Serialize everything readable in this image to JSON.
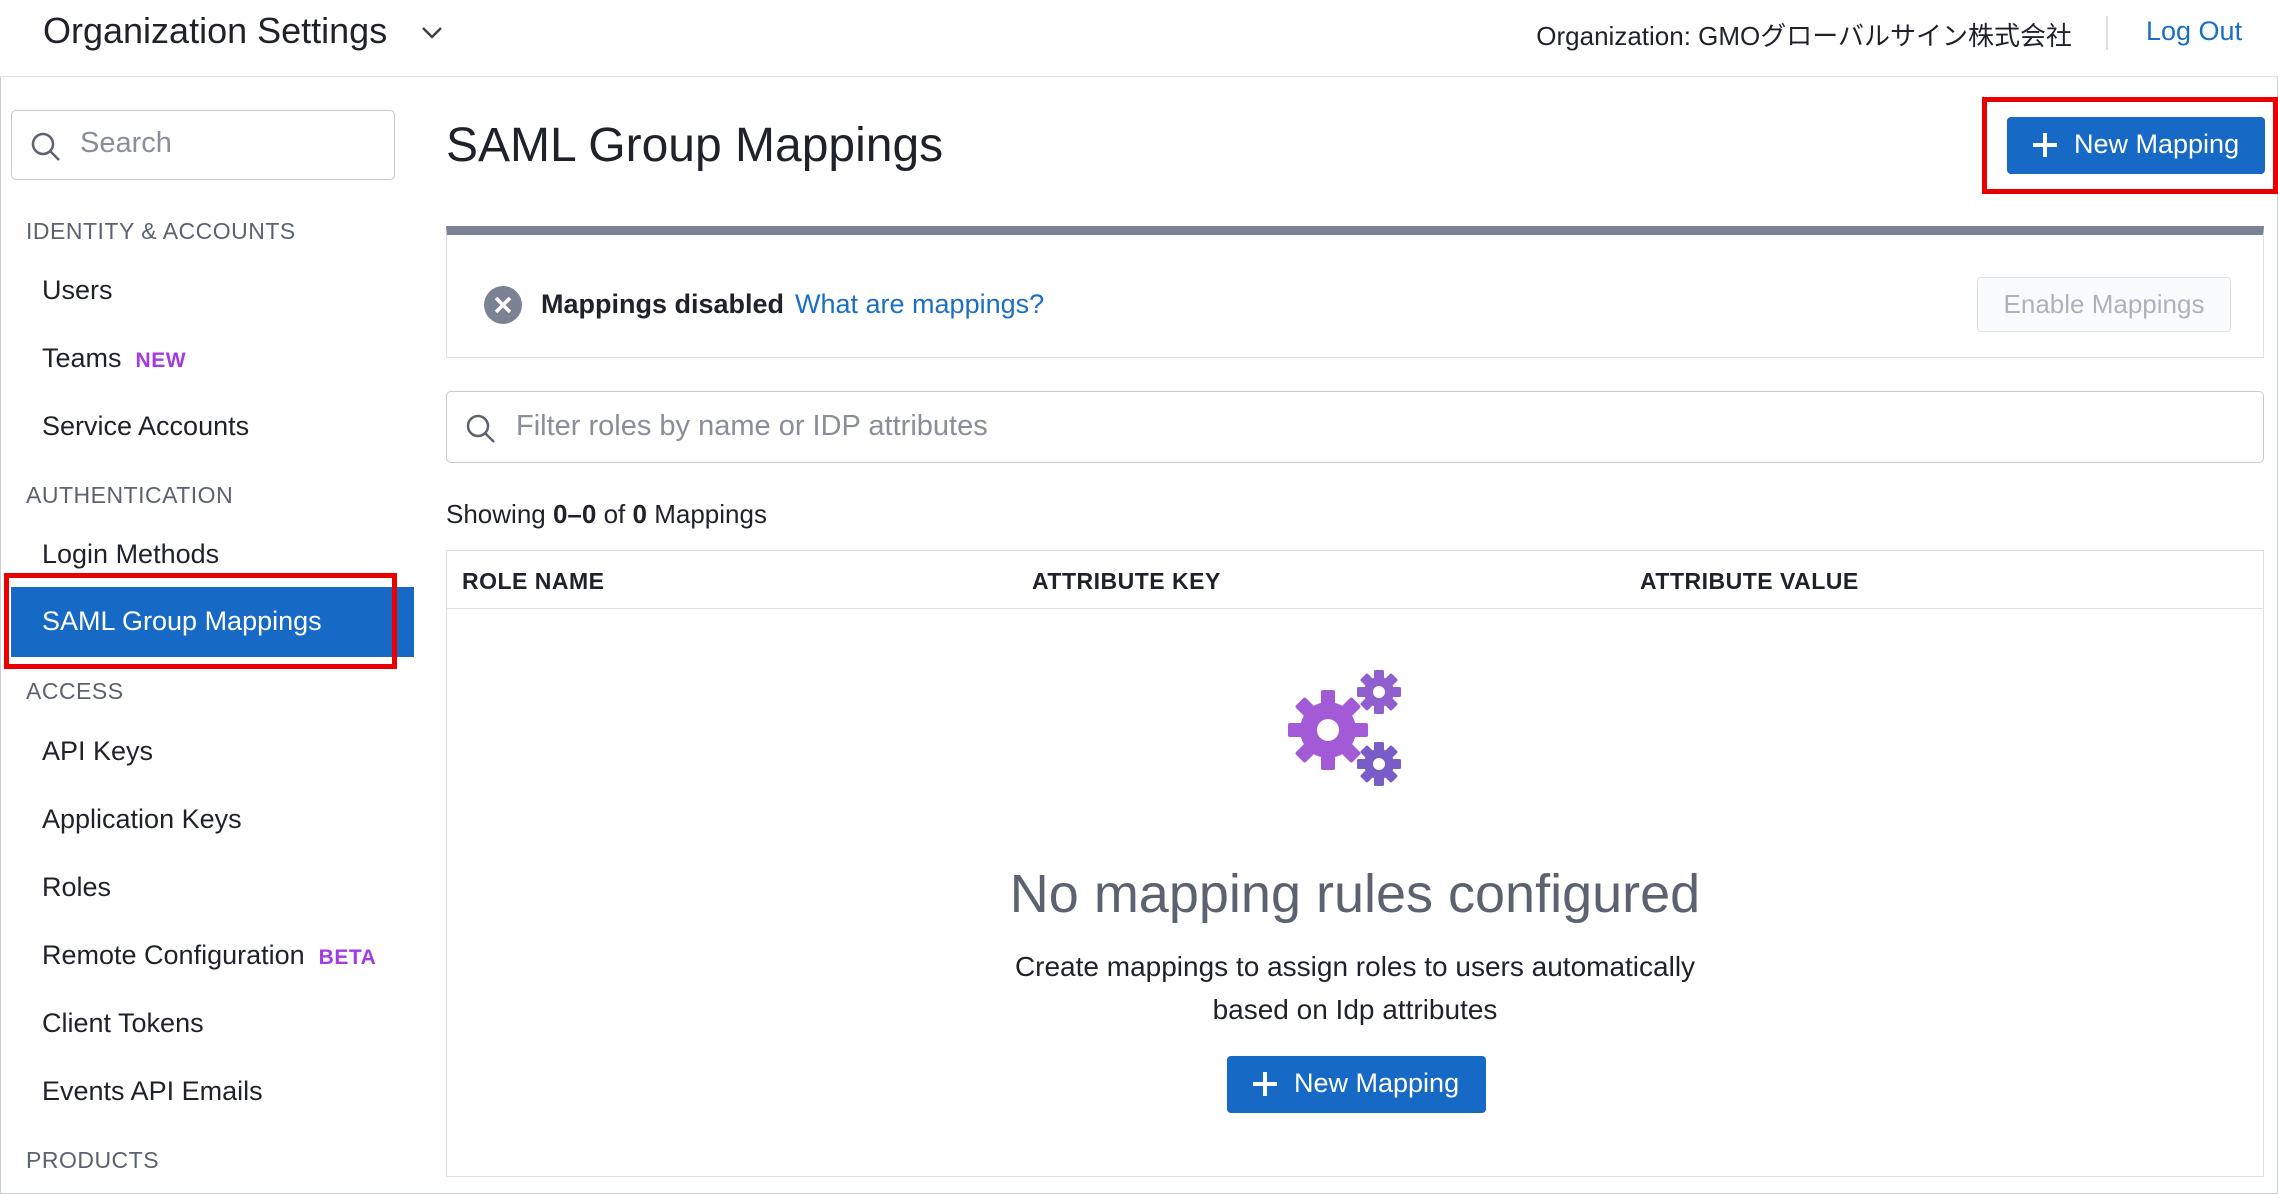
{
  "header": {
    "title": "Organization Settings",
    "organization_label": "Organization: GMOグローバルサイン株式会社",
    "logout_label": "Log Out"
  },
  "sidebar": {
    "search_placeholder": "Search",
    "sections": [
      {
        "label": "IDENTITY & ACCOUNTS"
      },
      {
        "label": "AUTHENTICATION"
      },
      {
        "label": "ACCESS"
      },
      {
        "label": "PRODUCTS"
      }
    ],
    "items": [
      {
        "label": "Users"
      },
      {
        "label": "Teams",
        "badge": "NEW"
      },
      {
        "label": "Service Accounts"
      },
      {
        "label": "Login Methods"
      },
      {
        "label": "SAML Group Mappings",
        "active": true
      },
      {
        "label": "API Keys"
      },
      {
        "label": "Application Keys"
      },
      {
        "label": "Roles"
      },
      {
        "label": "Remote Configuration",
        "badge": "BETA"
      },
      {
        "label": "Client Tokens"
      },
      {
        "label": "Events API Emails"
      }
    ]
  },
  "main": {
    "page_title": "SAML Group Mappings",
    "new_mapping_label": "New Mapping",
    "status": {
      "text": "Mappings disabled",
      "link": "What are mappings?",
      "enable_label": "Enable Mappings"
    },
    "filter_placeholder": "Filter roles by name or IDP attributes",
    "showing": {
      "prefix": "Showing",
      "range": "0–0",
      "of": "of",
      "total": "0",
      "suffix": "Mappings"
    },
    "table": {
      "columns": [
        "ROLE NAME",
        "ATTRIBUTE KEY",
        "ATTRIBUTE VALUE"
      ]
    },
    "empty_state": {
      "title": "No mapping rules configured",
      "description_line1": "Create mappings to assign roles to users automatically",
      "description_line2": "based on Idp attributes",
      "button_label": "New Mapping"
    }
  },
  "colors": {
    "primary": "#1769c6",
    "link": "#1a6fc4",
    "badge": "#a23ae6",
    "highlight": "#ea0000"
  }
}
